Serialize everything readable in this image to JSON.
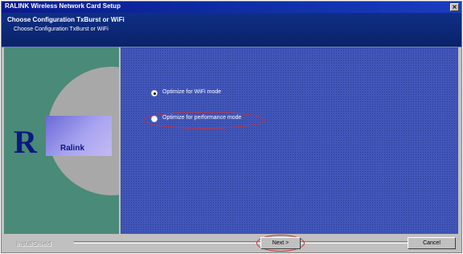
{
  "window": {
    "title": "RALINK Wireless Network Card Setup",
    "close_glyph": "×"
  },
  "header": {
    "title": "Choose Configuration TxBurst or WiFi",
    "subtitle": "Choose Configuration TxBurst or WiFi"
  },
  "logo": {
    "letter": "R",
    "text": "Ralink"
  },
  "options": [
    {
      "label": "Optimize for WiFi mode",
      "checked": true
    },
    {
      "label": "Optimize for performance mode",
      "checked": false
    }
  ],
  "footer": {
    "install_label": "InstallShield",
    "next_label": "Next >",
    "cancel_label": "Cancel"
  },
  "colors": {
    "titlebar": "#0a1a8c",
    "header": "#0f2f84",
    "left_panel": "#4a8a78",
    "right_panel": "#4156b8",
    "highlight_oval": "#d03030"
  }
}
